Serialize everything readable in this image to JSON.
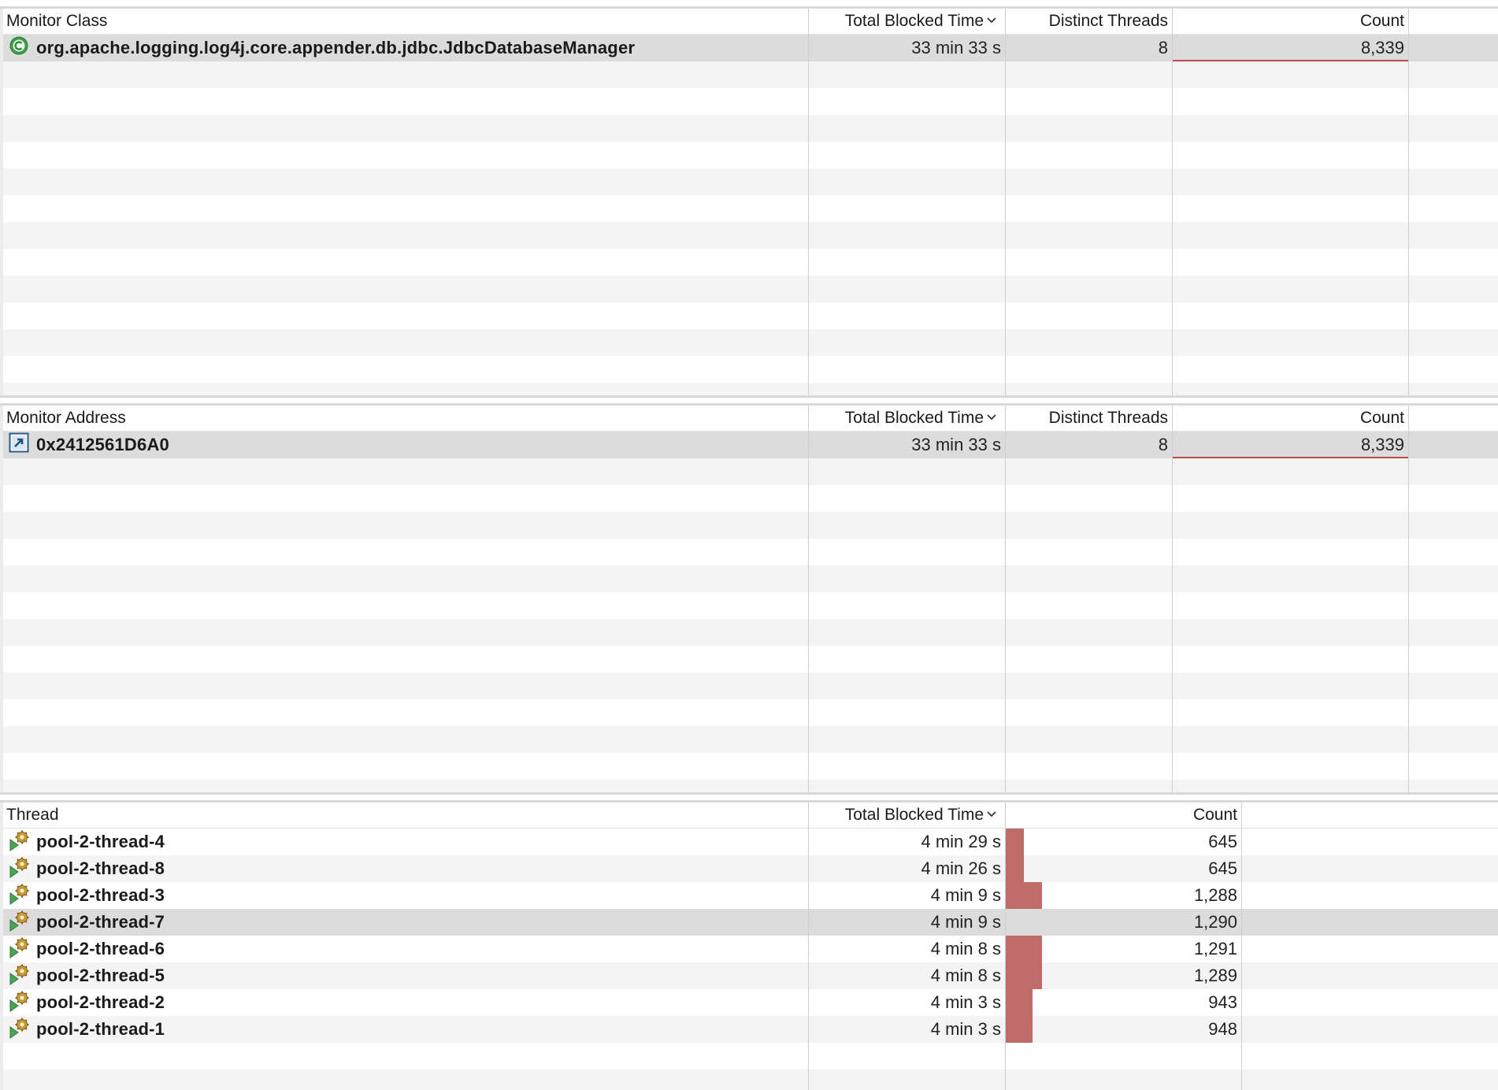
{
  "monitor_class_table": {
    "headers": {
      "name": "Monitor Class",
      "total_blocked_time": "Total Blocked Time",
      "distinct_threads": "Distinct Threads",
      "count": "Count"
    },
    "rows": [
      {
        "name": "org.apache.logging.log4j.core.appender.db.jdbc.JdbcDatabaseManager",
        "total_blocked_time": "33 min 33 s",
        "distinct_threads": "8",
        "count": "8,339",
        "icon": "class-icon"
      }
    ]
  },
  "monitor_address_table": {
    "headers": {
      "name": "Monitor Address",
      "total_blocked_time": "Total Blocked Time",
      "distinct_threads": "Distinct Threads",
      "count": "Count"
    },
    "rows": [
      {
        "name": "0x2412561D6A0",
        "total_blocked_time": "33 min 33 s",
        "distinct_threads": "8",
        "count": "8,339",
        "icon": "address-link-icon"
      }
    ]
  },
  "thread_table": {
    "headers": {
      "name": "Thread",
      "total_blocked_time": "Total Blocked Time",
      "count": "Count"
    },
    "rows": [
      {
        "name": "pool-2-thread-4",
        "total_blocked_time": "4 min 29 s",
        "count": "645",
        "count_bar_fraction": 0.5
      },
      {
        "name": "pool-2-thread-8",
        "total_blocked_time": "4 min 26 s",
        "count": "645",
        "count_bar_fraction": 0.5
      },
      {
        "name": "pool-2-thread-3",
        "total_blocked_time": "4 min 9 s",
        "count": "1,288",
        "count_bar_fraction": 0.998
      },
      {
        "name": "pool-2-thread-7",
        "total_blocked_time": "4 min 9 s",
        "count": "1,290",
        "count_bar_fraction": 0.999
      },
      {
        "name": "pool-2-thread-6",
        "total_blocked_time": "4 min 8 s",
        "count": "1,291",
        "count_bar_fraction": 1.0
      },
      {
        "name": "pool-2-thread-5",
        "total_blocked_time": "4 min 8 s",
        "count": "1,289",
        "count_bar_fraction": 0.998
      },
      {
        "name": "pool-2-thread-2",
        "total_blocked_time": "4 min 3 s",
        "count": "943",
        "count_bar_fraction": 0.73
      },
      {
        "name": "pool-2-thread-1",
        "total_blocked_time": "4 min 3 s",
        "count": "948",
        "count_bar_fraction": 0.734
      }
    ],
    "selected_row": "pool-2-thread-7",
    "icon": "running-thread-icon"
  },
  "colors": {
    "count_bar": "#bf6b6a",
    "selected_row": "#dcdcdc",
    "stripe": "#f4f4f4",
    "count_underline": "#c44a48"
  }
}
